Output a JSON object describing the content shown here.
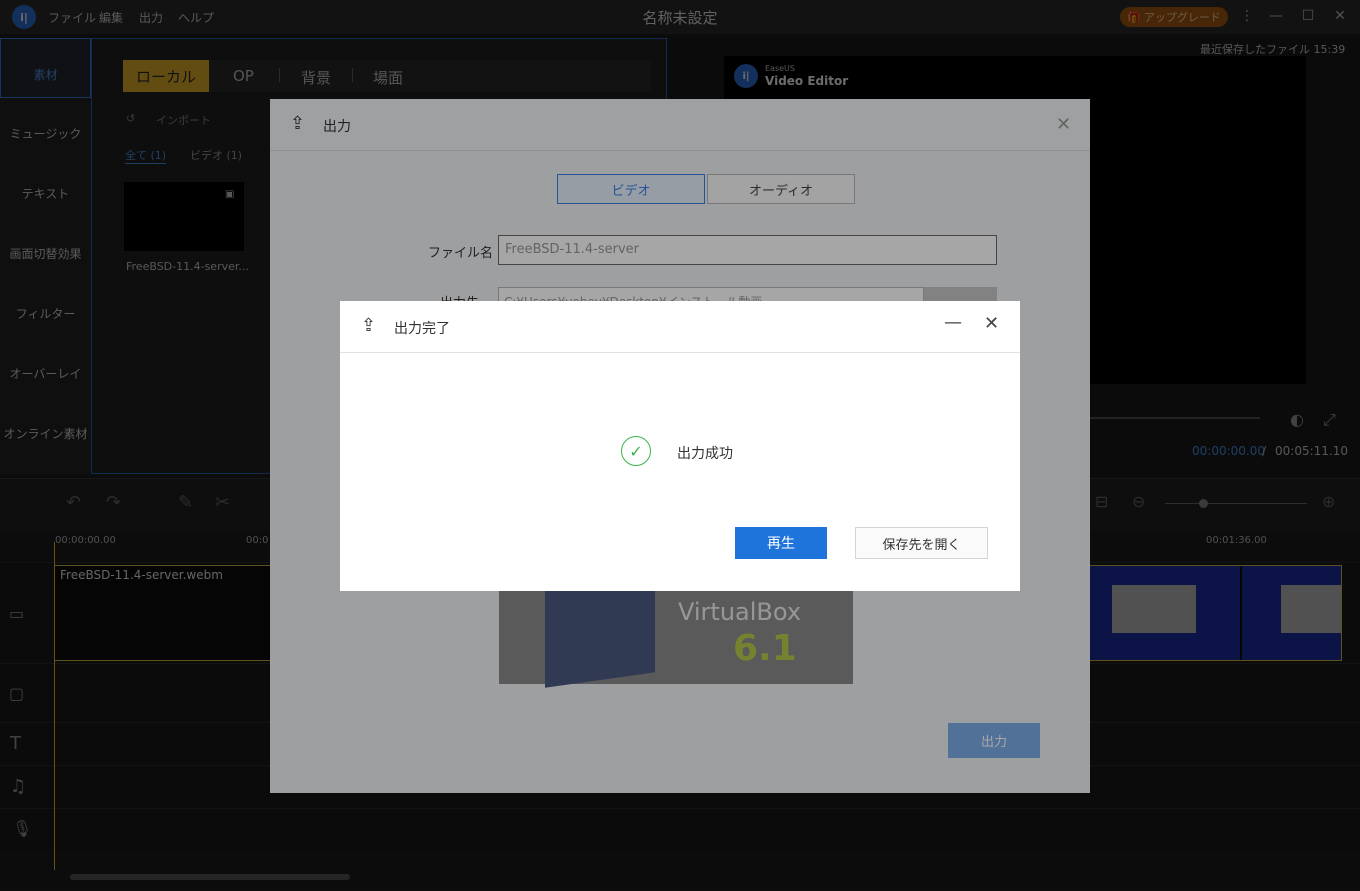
{
  "titlebar": {
    "menu": [
      "ファイル",
      "編集",
      "出力",
      "ヘルプ"
    ],
    "title": "名称未設定",
    "upgrade_label": "アップグレード",
    "logo_text": "i|"
  },
  "sidebar": {
    "items": [
      "素材",
      "ミュージック",
      "テキスト",
      "画面切替効果",
      "フィルター",
      "オーバーレイ",
      "オンライン素材"
    ]
  },
  "media": {
    "tabs": [
      "ローカル",
      "OP",
      "背景",
      "場面"
    ],
    "import_label": "インポート",
    "filter_all": "全て (1)",
    "filter_video": "ビデオ (1)",
    "item_label": "FreeBSD-11.4-server..."
  },
  "preview": {
    "saved_status": "最近保存したファイル 15:39",
    "brand_small": "EaseUS",
    "brand_big": "Video Editor",
    "time_current": "00:00:00.00",
    "time_sep": "/",
    "time_total": "00:05:11.10"
  },
  "timeline": {
    "ruler": [
      "00:00:00.00",
      "00:0",
      "00:01:36.00"
    ],
    "clip_label": "FreeBSD-11.4-server.webm"
  },
  "export_dialog": {
    "title": "出力",
    "tab_video": "ビデオ",
    "tab_audio": "オーディオ",
    "filename_label": "ファイル名",
    "filename_value": "FreeBSD-11.4-server",
    "dest_label": "出力先",
    "dest_value": "C:¥Users¥yohey¥Desktop¥インストール動画",
    "preview_word": "VirtualBox",
    "preview_ver": "6.1",
    "export_label": "出力"
  },
  "done_dialog": {
    "title": "出力完了",
    "message": "出力成功",
    "play_label": "再生",
    "open_label": "保存先を開く"
  },
  "colors": {
    "accent": "#1f74db",
    "success": "#3bb34a",
    "tab_active": "#e8b52a"
  }
}
